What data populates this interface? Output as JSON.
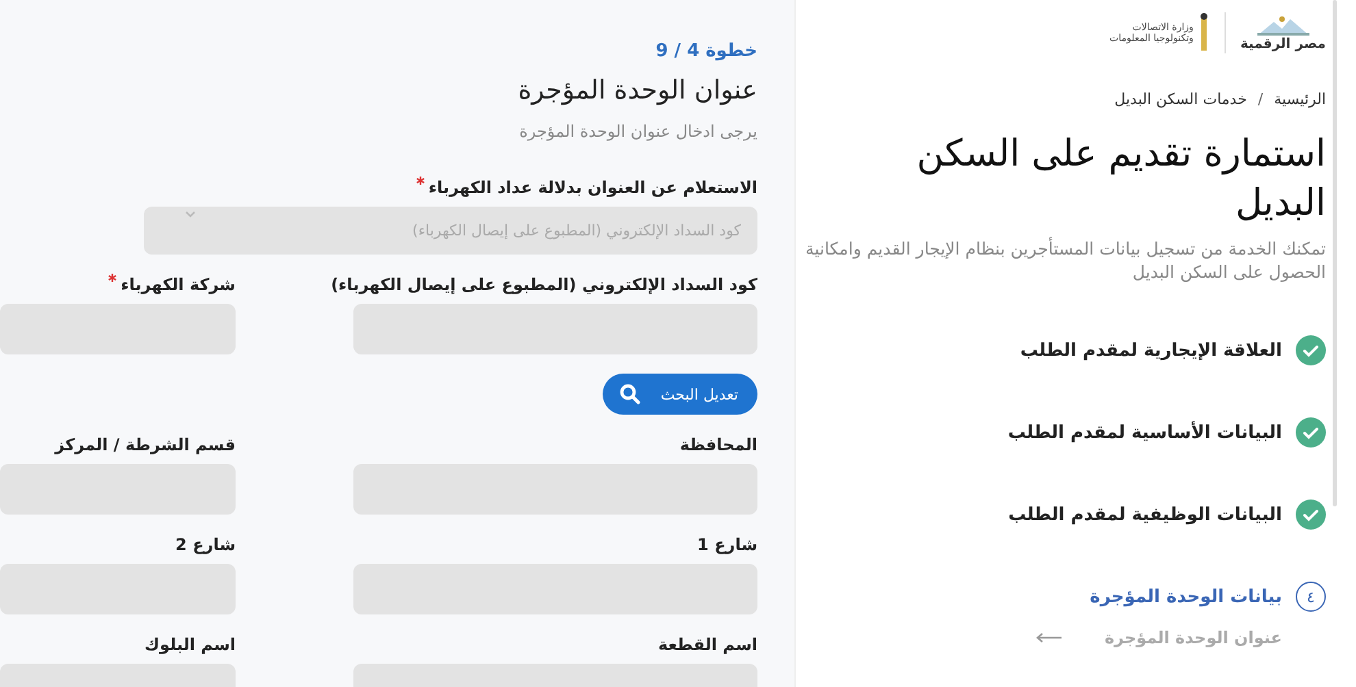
{
  "form": {
    "step": "خطوة 4 / 9",
    "title": "عنوان الوحدة المؤجرة",
    "subtitle": "يرجى ادخال عنوان الوحدة المؤجرة",
    "items": [
      {
        "kind": "select",
        "label": "الاستعلام عن العنوان بدلالة عداد الكهرباء",
        "required": true,
        "placeholder": "كود السداد الإلكتروني (المطبوع على إيصال الكهرباء)"
      },
      {
        "kind": "input",
        "label": "كود السداد الإلكتروني (المطبوع على إيصال الكهرباء)",
        "required": false
      },
      {
        "kind": "input",
        "label": "شركة الكهرباء",
        "required": true
      },
      {
        "kind": "button",
        "label": "تعديل البحث"
      },
      {
        "kind": "input",
        "label": "المحافظة",
        "required": false
      },
      {
        "kind": "input",
        "label": "قسم الشرطة / المركز",
        "required": false
      },
      {
        "kind": "input",
        "label": "شارع 1",
        "required": false
      },
      {
        "kind": "input",
        "label": "شارع 2",
        "required": false
      },
      {
        "kind": "input",
        "label": "اسم القطعة",
        "required": false
      },
      {
        "kind": "input",
        "label": "اسم البلوك",
        "required": false
      }
    ]
  },
  "sidebar": {
    "logo": "مصر الرقمية",
    "ministry": [
      "وزارة الاتصالات",
      "وتكنولوجيا المعلومات"
    ],
    "breadcrumb": [
      "الرئيسية",
      "خدمات السكن البديل"
    ],
    "breadcrumb_separator": "/",
    "title": "استمارة تقديم على السكن البديل",
    "description": "تمكنك الخدمة من تسجيل بيانات المستأجرين بنظام الإيجار القديم وامكانية الحصول على السكن البديل",
    "steps": [
      {
        "label": "العلاقة الإيجارية لمقدم الطلب",
        "kind": "completed"
      },
      {
        "label": "البيانات الأساسية لمقدم الطلب",
        "kind": "completed"
      },
      {
        "label": "البيانات الوظيفية لمقدم الطلب",
        "kind": "completed"
      },
      {
        "label": "بيانات الوحدة المؤجرة",
        "kind": "numbered",
        "number": "٤",
        "children": [
          {
            "label": "عنوان الوحدة المؤجرة"
          }
        ]
      }
    ]
  }
}
